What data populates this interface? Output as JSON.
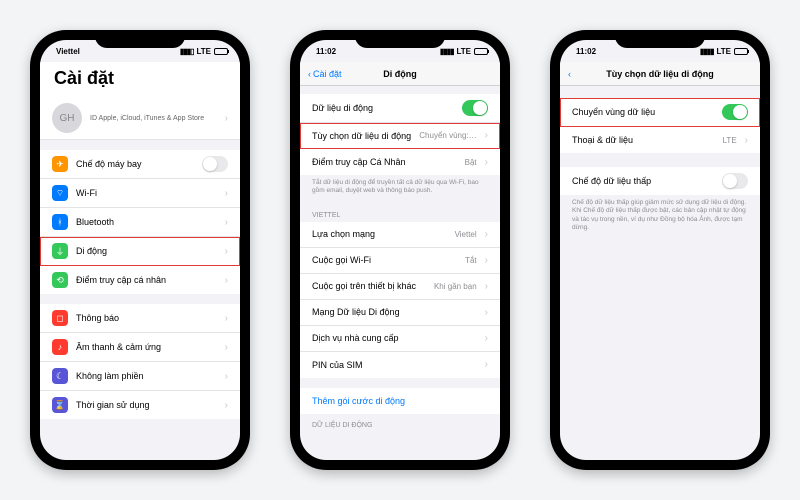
{
  "phone1": {
    "status": {
      "carrier": "Viettel",
      "net": "LTE"
    },
    "title": "Cài đặt",
    "profile": {
      "initials": "GH",
      "sub": "ID Apple, iCloud, iTunes & App Store"
    },
    "g1": {
      "airplane": "Chế độ máy bay",
      "wifi": "Wi-Fi",
      "bluetooth": "Bluetooth",
      "cellular": "Di động",
      "hotspot": "Điểm truy cập cá nhân"
    },
    "g2": {
      "notif": "Thông báo",
      "sound": "Âm thanh & cảm ứng",
      "dnd": "Không làm phiền",
      "screentime": "Thời gian sử dụng"
    }
  },
  "phone2": {
    "status": {
      "time": "11:02",
      "net": "LTE"
    },
    "back": "Cài đặt",
    "title": "Di động",
    "r": {
      "data": "Dữ liệu di động",
      "opts": "Tùy chọn dữ liệu di động",
      "opts_val": "Chuyển vùng:…",
      "hotspot": "Điểm truy cập Cá Nhân",
      "hotspot_val": "Bật"
    },
    "note1": "Tắt dữ liệu di động để truyền tất cả dữ liệu qua Wi-Fi, bao gồm email, duyệt web và thông báo push.",
    "carrier_hdr": "VIETTEL",
    "r2": {
      "netsel": "Lựa chọn mạng",
      "netsel_val": "Viettel",
      "wificall": "Cuộc gọi Wi-Fi",
      "wificall_val": "Tắt",
      "other": "Cuộc gọi trên thiết bị khác",
      "other_val": "Khi gần bạn",
      "cdn": "Mạng Dữ liệu Di động",
      "svc": "Dịch vụ nhà cung cấp",
      "pin": "PIN của SIM"
    },
    "addplan": "Thêm gói cước di động",
    "data_hdr": "DỮ LIỆU DI ĐỘNG"
  },
  "phone3": {
    "status": {
      "time": "11:02",
      "net": "LTE"
    },
    "title": "Tùy chọn dữ liệu di động",
    "r": {
      "roam": "Chuyển vùng dữ liệu",
      "voice": "Thoại & dữ liệu",
      "voice_val": "LTE"
    },
    "low": "Chế độ dữ liệu thấp",
    "note": "Chế độ dữ liệu thấp giúp giảm mức sử dụng dữ liệu di động. Khi Chế độ dữ liệu thấp được bật, các bản cập nhật tự động và tác vụ trong nền, ví dụ như Đồng bộ hóa Ảnh, được tạm dừng."
  }
}
